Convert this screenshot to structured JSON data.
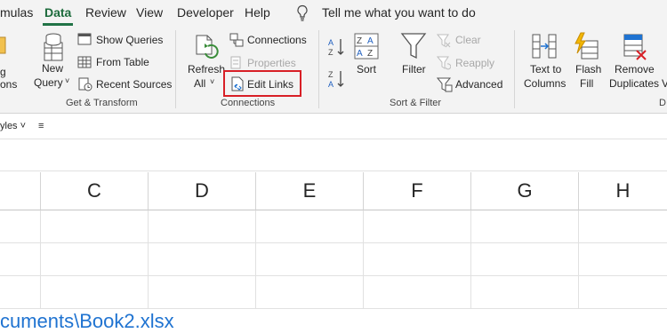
{
  "menu": {
    "tabs": [
      "mulas",
      "Data",
      "Review",
      "View",
      "Developer",
      "Help"
    ],
    "active_tab": "Data",
    "tell_me": "Tell me what you want to do"
  },
  "ribbon": {
    "get_transform": {
      "partial_label": "g",
      "partial_label2": "ons",
      "new_query": "New",
      "new_query2": "Query",
      "show_queries": "Show Queries",
      "from_table": "From Table",
      "recent_sources": "Recent Sources",
      "group_label": "Get & Transform"
    },
    "connections": {
      "refresh": "Refresh",
      "refresh2": "All",
      "connections": "Connections",
      "properties": "Properties",
      "edit_links": "Edit Links",
      "group_label": "Connections"
    },
    "sort_filter": {
      "sort": "Sort",
      "filter": "Filter",
      "clear": "Clear",
      "reapply": "Reapply",
      "advanced": "Advanced",
      "group_label": "Sort & Filter"
    },
    "data_tools": {
      "text_to_columns": "Text to",
      "text_to_columns2": "Columns",
      "flash_fill": "Flash",
      "flash_fill2": "Fill",
      "remove_duplicates": "Remove",
      "remove_duplicates2": "Duplicates",
      "partial_label": "D"
    }
  },
  "stylebar": {
    "styles": "yles ˅",
    "more": "≡"
  },
  "grid": {
    "columns": [
      "C",
      "D",
      "E",
      "F",
      "G",
      "H"
    ],
    "link_text": "cuments\\Book2.xlsx"
  },
  "colors": {
    "accent": "#217346",
    "highlight": "#d81f26",
    "link": "#1f73d1"
  }
}
